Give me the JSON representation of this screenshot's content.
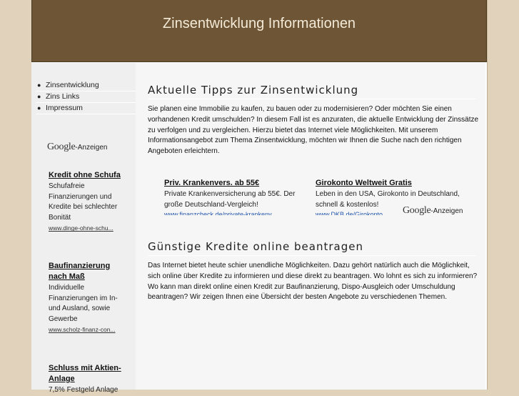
{
  "header": {
    "title": "Zinsentwicklung Informationen"
  },
  "sidebar": {
    "nav": [
      {
        "label": "Zinsentwicklung"
      },
      {
        "label": "Zins Links"
      },
      {
        "label": "Impressum"
      }
    ],
    "google_ads_logo": "Google",
    "google_ads_label": "-Anzeigen",
    "ads": [
      {
        "title": "Kredit ohne Schufa",
        "text": "Schufafreie Finanzierungen und Kredite bei schlechter Bonität",
        "url": "www.dinge-ohne-schu..."
      },
      {
        "title": "Baufinanzierung nach Maß",
        "text": "Individuelle Finanzierungen im In- und Ausland, sowie Gewerbe",
        "url": "www.scholz-finanz-con..."
      },
      {
        "title": "Schluss mit Aktien-Anlage",
        "text": "7,5% Festgeld Anlage"
      }
    ]
  },
  "main": {
    "heading1": "Aktuelle Tipps zur Zinsentwicklung",
    "paragraph1": "Sie planen eine Immobilie zu kaufen, zu bauen oder zu modernisieren? Oder möchten Sie einen vorhandenen Kredit umschulden? In diesem Fall ist es anzuraten, die aktuelle Entwicklung der Zinssätze zu verfolgen und zu vergleichen. Hierzu bietet das Internet viele Möglichkeiten. Mit unserem Informationsangebot zum Thema Zinsentwicklung, möchten wir Ihnen die Suche nach den richtigen Angeboten erleichtern.",
    "ads": [
      {
        "title": "Priv. Krankenvers. ab 55€",
        "text": "Private Krankenversicherung ab 55€. Der große Deutschland-Vergleich!",
        "url": "www.finanzcheck.de/private-krankenv"
      },
      {
        "title": "Girokonto Weltweit Gratis",
        "text": "Leben in den USA, Girokonto in Deutschland, schnell & kostenlos!",
        "url": "www.DKB.de/Girokonto"
      }
    ],
    "google_ads_logo": "Google",
    "google_ads_label": "-Anzeigen",
    "heading2": "Günstige Kredite online beantragen",
    "paragraph2": "Das Internet bietet heute schier unendliche Möglichkeiten. Dazu gehört natürlich auch die Möglichkeit, sich online über Kredite zu informieren und diese direkt zu beantragen. Wo lohnt es sich zu informieren? Wo kann man direkt online einen Kredit zur Baufinanzierung, Dispo-Ausgleich oder Umschuldung beantragen? Wir zeigen Ihnen eine Übersicht der besten Angebote zu verschiedenen Themen."
  },
  "colors": {
    "header_bg": "#6d5535",
    "page_bg": "#e0d2bb",
    "sidebar_bg": "#efefef",
    "main_bg": "#f6f6f6"
  }
}
